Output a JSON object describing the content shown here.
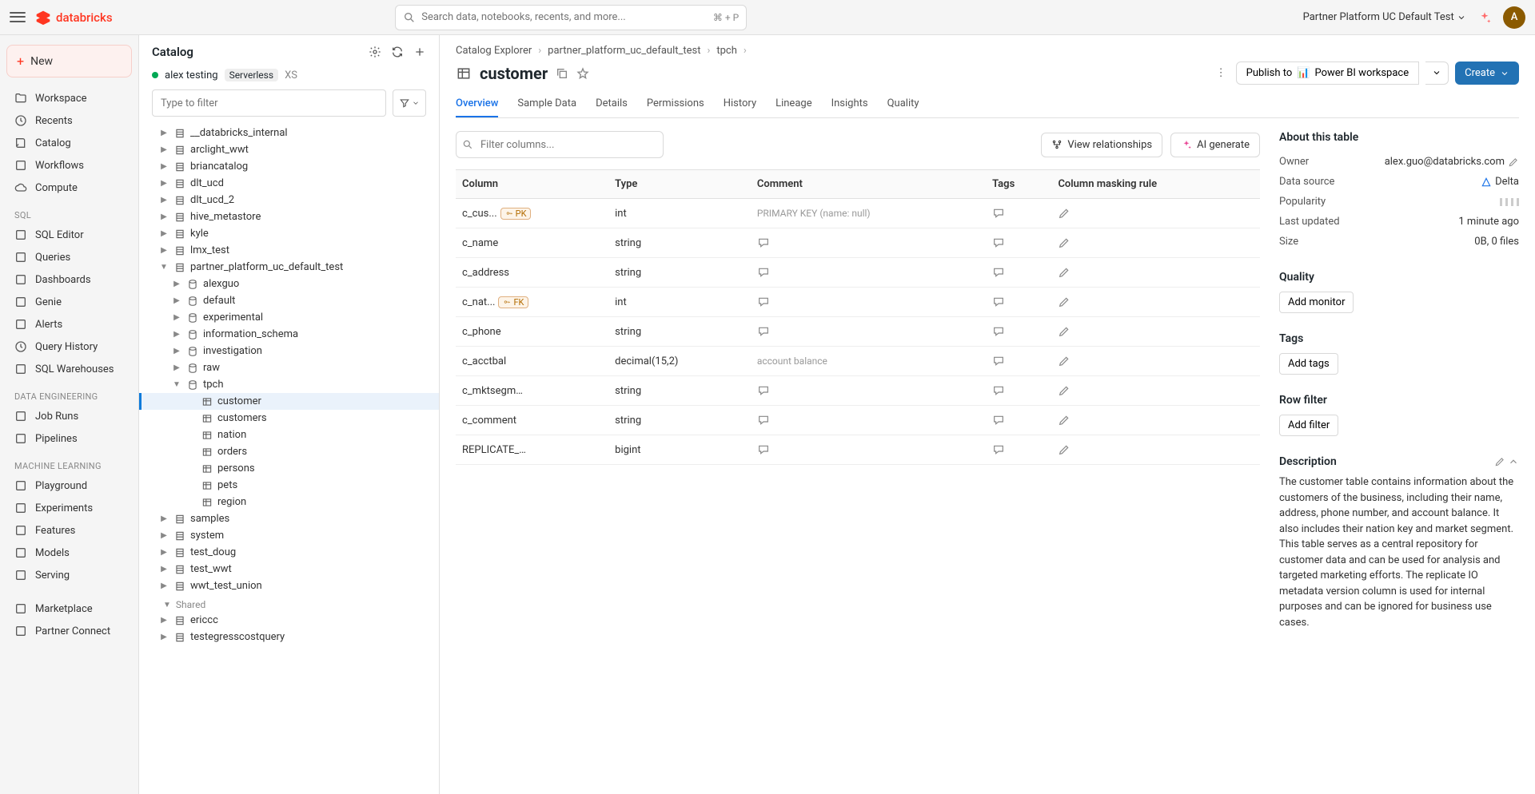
{
  "topbar": {
    "logo": "databricks",
    "search_placeholder": "Search data, notebooks, recents, and more...",
    "search_shortcut": "⌘ + P",
    "workspace": "Partner Platform UC Default Test",
    "avatar_initial": "A"
  },
  "sidebar": {
    "new_label": "New",
    "main": [
      {
        "icon": "folder",
        "label": "Workspace"
      },
      {
        "icon": "clock",
        "label": "Recents"
      },
      {
        "icon": "book",
        "label": "Catalog"
      },
      {
        "icon": "flow",
        "label": "Workflows"
      },
      {
        "icon": "cloud",
        "label": "Compute"
      }
    ],
    "sql_label": "SQL",
    "sql": [
      {
        "icon": "sql",
        "label": "SQL Editor"
      },
      {
        "icon": "query",
        "label": "Queries"
      },
      {
        "icon": "dashboard",
        "label": "Dashboards"
      },
      {
        "icon": "genie",
        "label": "Genie"
      },
      {
        "icon": "alert",
        "label": "Alerts"
      },
      {
        "icon": "history",
        "label": "Query History"
      },
      {
        "icon": "warehouse",
        "label": "SQL Warehouses"
      }
    ],
    "de_label": "Data Engineering",
    "de": [
      {
        "icon": "runs",
        "label": "Job Runs"
      },
      {
        "icon": "pipeline",
        "label": "Pipelines"
      }
    ],
    "ml_label": "Machine Learning",
    "ml": [
      {
        "icon": "playground",
        "label": "Playground"
      },
      {
        "icon": "flask",
        "label": "Experiments"
      },
      {
        "icon": "features",
        "label": "Features"
      },
      {
        "icon": "models",
        "label": "Models"
      },
      {
        "icon": "serving",
        "label": "Serving"
      }
    ],
    "bottom": [
      {
        "icon": "market",
        "label": "Marketplace"
      },
      {
        "icon": "partner",
        "label": "Partner Connect"
      }
    ]
  },
  "catalog": {
    "title": "Catalog",
    "cluster_name": "alex testing",
    "cluster_badge": "Serverless",
    "cluster_size": "XS",
    "filter_placeholder": "Type to filter",
    "tree_l0": [
      "__databricks_internal",
      "arclight_wwt",
      "briancatalog",
      "dlt_ucd",
      "dlt_ucd_2",
      "hive_metastore",
      "kyle",
      "lmx_test"
    ],
    "expanded_catalog": "partner_platform_uc_default_test",
    "schemas": [
      "alexguo",
      "default",
      "experimental",
      "information_schema",
      "investigation",
      "raw"
    ],
    "expanded_schema": "tpch",
    "tables": [
      "customer",
      "customers",
      "nation",
      "orders",
      "persons",
      "pets",
      "region"
    ],
    "after_catalogs": [
      "samples",
      "system",
      "test_doug",
      "test_wwt",
      "wwt_test_union"
    ],
    "shared_label": "Shared",
    "shared": [
      "ericcc",
      "testegresscostquery"
    ]
  },
  "breadcrumb": {
    "root": "Catalog Explorer",
    "catalog": "partner_platform_uc_default_test",
    "schema": "tpch"
  },
  "page": {
    "title": "customer",
    "publish_label": "Publish to",
    "publish_target": "Power BI workspace",
    "create_label": "Create"
  },
  "tabs": [
    "Overview",
    "Sample Data",
    "Details",
    "Permissions",
    "History",
    "Lineage",
    "Insights",
    "Quality"
  ],
  "toolbar": {
    "filter_placeholder": "Filter columns...",
    "view_rel": "View relationships",
    "ai_gen": "AI generate"
  },
  "table": {
    "headers": [
      "Column",
      "Type",
      "Comment",
      "Tags",
      "Column masking rule"
    ],
    "rows": [
      {
        "name": "c_cus...",
        "key": "PK",
        "type": "int",
        "comment": "PRIMARY KEY (name: null)",
        "comment_style": "light"
      },
      {
        "name": "c_name",
        "type": "string"
      },
      {
        "name": "c_address",
        "type": "string"
      },
      {
        "name": "c_nat...",
        "key": "FK",
        "type": "int"
      },
      {
        "name": "c_phone",
        "type": "string"
      },
      {
        "name": "c_acctbal",
        "type": "decimal(15,2)",
        "comment": "account balance",
        "comment_style": "light"
      },
      {
        "name": "c_mktsegment",
        "type": "string"
      },
      {
        "name": "c_comment",
        "type": "string"
      },
      {
        "name": "REPLICATE_I...",
        "type": "bigint"
      }
    ]
  },
  "about": {
    "title": "About this table",
    "owner_label": "Owner",
    "owner": "alex.guo@databricks.com",
    "datasource_label": "Data source",
    "datasource": "Delta",
    "popularity_label": "Popularity",
    "lastupdated_label": "Last updated",
    "lastupdated": "1 minute ago",
    "size_label": "Size",
    "size": "0B, 0 files"
  },
  "quality": {
    "title": "Quality",
    "btn": "Add monitor"
  },
  "tags_section": {
    "title": "Tags",
    "btn": "Add tags"
  },
  "rowfilter": {
    "title": "Row filter",
    "btn": "Add filter"
  },
  "description": {
    "title": "Description",
    "text": "The customer table contains information about the customers of the business, including their name, address, phone number, and account balance. It also includes their nation key and market segment. This table serves as a central repository for customer data and can be used for analysis and targeted marketing efforts. The replicate IO metadata version column is used for internal purposes and can be ignored for business use cases."
  }
}
